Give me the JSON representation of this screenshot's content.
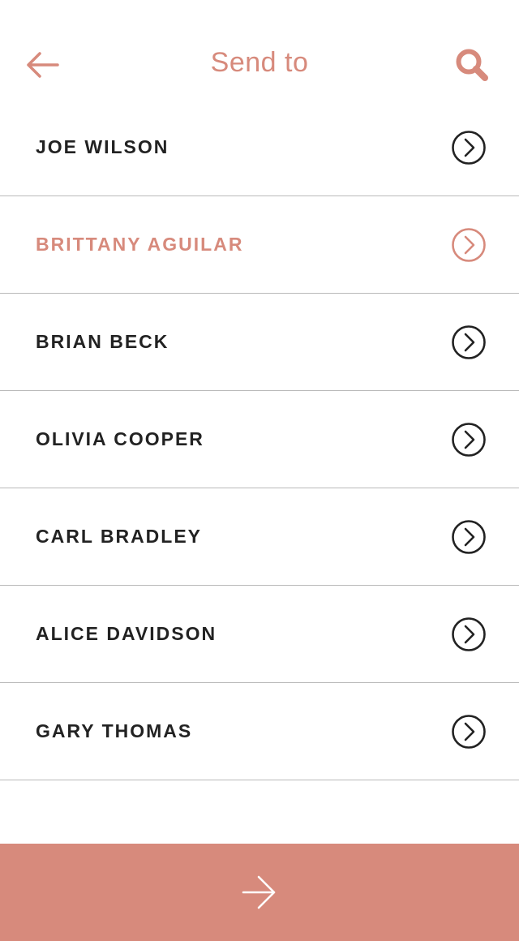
{
  "colors": {
    "accent": "#d78a7c",
    "text": "#222222",
    "divider": "#b9b9b9",
    "background": "#ffffff"
  },
  "header": {
    "title": "Send to",
    "back_icon": "arrow-left-icon",
    "search_icon": "search-icon"
  },
  "contacts": [
    {
      "name": "JOE WILSON",
      "selected": false
    },
    {
      "name": "BRITTANY AGUILAR",
      "selected": true
    },
    {
      "name": "BRIAN BECK",
      "selected": false
    },
    {
      "name": "OLIVIA COOPER",
      "selected": false
    },
    {
      "name": "CARL BRADLEY",
      "selected": false
    },
    {
      "name": "ALICE DAVIDSON",
      "selected": false
    },
    {
      "name": "GARY THOMAS",
      "selected": false
    }
  ],
  "footer": {
    "icon": "arrow-right-icon"
  }
}
